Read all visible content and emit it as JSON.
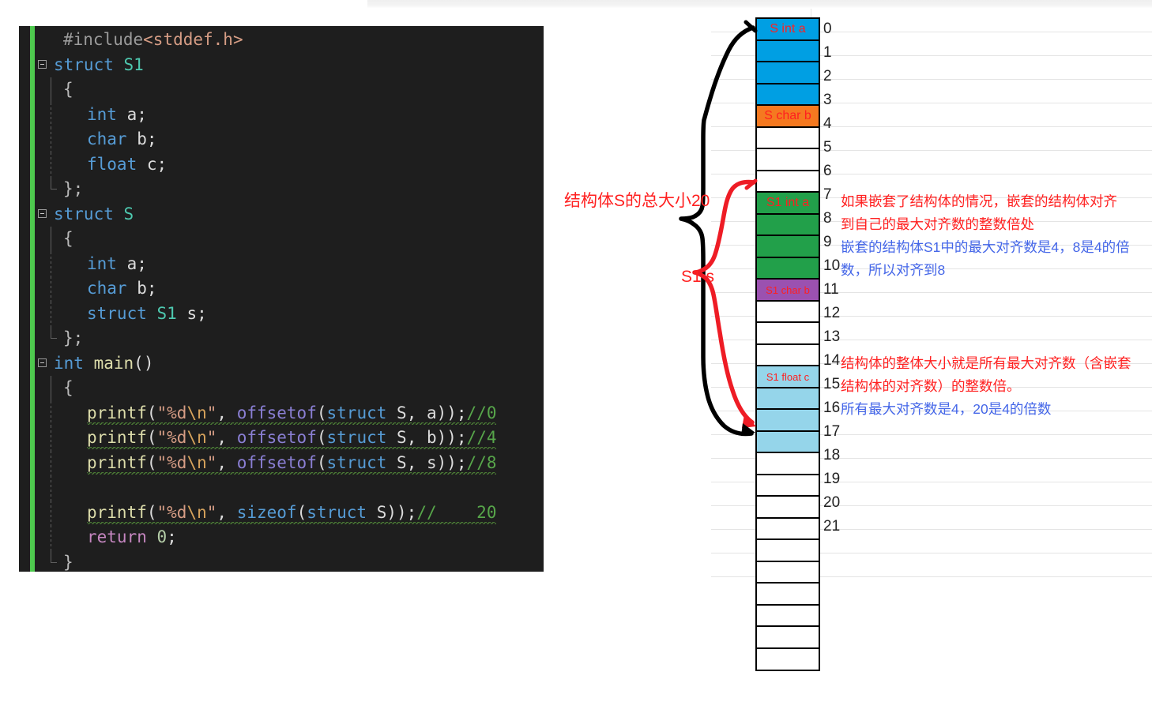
{
  "code_editor": {
    "lines": [
      [
        {
          "t": "#include",
          "c": "c-pp"
        },
        {
          "t": "<stddef.h>",
          "c": "c-ppfile"
        }
      ],
      [
        {
          "t": "struct ",
          "c": "c-key"
        },
        {
          "t": "S1",
          "c": "c-type"
        }
      ],
      [
        {
          "t": "{",
          "c": "c-dim"
        }
      ],
      [
        {
          "t": "int",
          "c": "c-key"
        },
        {
          "t": " a;",
          "c": "c-plain"
        }
      ],
      [
        {
          "t": "char",
          "c": "c-key"
        },
        {
          "t": " b;",
          "c": "c-plain"
        }
      ],
      [
        {
          "t": "float",
          "c": "c-key"
        },
        {
          "t": " c;",
          "c": "c-plain"
        }
      ],
      [
        {
          "t": "};",
          "c": "c-dim"
        }
      ],
      [
        {
          "t": "struct ",
          "c": "c-key"
        },
        {
          "t": "S",
          "c": "c-type"
        }
      ],
      [
        {
          "t": "{",
          "c": "c-dim"
        }
      ],
      [
        {
          "t": "int",
          "c": "c-key"
        },
        {
          "t": " a;",
          "c": "c-plain"
        }
      ],
      [
        {
          "t": "char",
          "c": "c-key"
        },
        {
          "t": " b;",
          "c": "c-plain"
        }
      ],
      [
        {
          "t": "struct ",
          "c": "c-key"
        },
        {
          "t": "S1",
          "c": "c-type"
        },
        {
          "t": " s;",
          "c": "c-plain"
        }
      ],
      [
        {
          "t": "};",
          "c": "c-dim"
        }
      ],
      [
        {
          "t": "int",
          "c": "c-key"
        },
        {
          "t": " ",
          "c": "c-plain"
        },
        {
          "t": "main",
          "c": "c-fn"
        },
        {
          "t": "()",
          "c": "c-punc"
        }
      ],
      [
        {
          "t": "{",
          "c": "c-dim"
        }
      ],
      [
        {
          "t": "printf",
          "c": "c-fn"
        },
        {
          "t": "(",
          "c": "c-punc"
        },
        {
          "t": "\"%d",
          "c": "c-str"
        },
        {
          "t": "\\n",
          "c": "c-esc"
        },
        {
          "t": "\"",
          "c": "c-str"
        },
        {
          "t": ", ",
          "c": "c-punc"
        },
        {
          "t": "offsetof",
          "c": "c-macro"
        },
        {
          "t": "(",
          "c": "c-punc"
        },
        {
          "t": "struct ",
          "c": "c-key"
        },
        {
          "t": "S",
          "c": "c-plain"
        },
        {
          "t": ", a));",
          "c": "c-punc"
        },
        {
          "t": "//0",
          "c": "c-cmt"
        }
      ],
      [
        {
          "t": "printf",
          "c": "c-fn"
        },
        {
          "t": "(",
          "c": "c-punc"
        },
        {
          "t": "\"%d",
          "c": "c-str"
        },
        {
          "t": "\\n",
          "c": "c-esc"
        },
        {
          "t": "\"",
          "c": "c-str"
        },
        {
          "t": ", ",
          "c": "c-punc"
        },
        {
          "t": "offsetof",
          "c": "c-macro"
        },
        {
          "t": "(",
          "c": "c-punc"
        },
        {
          "t": "struct ",
          "c": "c-key"
        },
        {
          "t": "S",
          "c": "c-plain"
        },
        {
          "t": ", b));",
          "c": "c-punc"
        },
        {
          "t": "//4",
          "c": "c-cmt"
        }
      ],
      [
        {
          "t": "printf",
          "c": "c-fn"
        },
        {
          "t": "(",
          "c": "c-punc"
        },
        {
          "t": "\"%d",
          "c": "c-str"
        },
        {
          "t": "\\n",
          "c": "c-esc"
        },
        {
          "t": "\"",
          "c": "c-str"
        },
        {
          "t": ", ",
          "c": "c-punc"
        },
        {
          "t": "offsetof",
          "c": "c-macro"
        },
        {
          "t": "(",
          "c": "c-punc"
        },
        {
          "t": "struct ",
          "c": "c-key"
        },
        {
          "t": "S",
          "c": "c-plain"
        },
        {
          "t": ", s));",
          "c": "c-punc"
        },
        {
          "t": "//8",
          "c": "c-cmt"
        }
      ],
      [],
      [
        {
          "t": "printf",
          "c": "c-fn"
        },
        {
          "t": "(",
          "c": "c-punc"
        },
        {
          "t": "\"%d",
          "c": "c-str"
        },
        {
          "t": "\\n",
          "c": "c-esc"
        },
        {
          "t": "\"",
          "c": "c-str"
        },
        {
          "t": ", ",
          "c": "c-punc"
        },
        {
          "t": "sizeof",
          "c": "c-key"
        },
        {
          "t": "(",
          "c": "c-punc"
        },
        {
          "t": "struct ",
          "c": "c-key"
        },
        {
          "t": "S",
          "c": "c-plain"
        },
        {
          "t": "));",
          "c": "c-punc"
        },
        {
          "t": "//    20",
          "c": "c-cmt"
        }
      ],
      [
        {
          "t": "return",
          "c": "c-ret"
        },
        {
          "t": " ",
          "c": "c-plain"
        },
        {
          "t": "0",
          "c": "c-num"
        },
        {
          "t": ";",
          "c": "c-punc"
        }
      ],
      [
        {
          "t": "}",
          "c": "c-dim"
        }
      ]
    ]
  },
  "memory_map": {
    "cells": [
      {
        "index": "0",
        "label": "S int a",
        "color": "#009FE3",
        "show_index": true
      },
      {
        "index": "1",
        "label": "",
        "color": "#009FE3",
        "show_index": true
      },
      {
        "index": "2",
        "label": "",
        "color": "#009FE3",
        "show_index": true
      },
      {
        "index": "3",
        "label": "",
        "color": "#009FE3",
        "show_index": true
      },
      {
        "index": "4",
        "label": "S char b",
        "color": "#F57920",
        "show_index": true
      },
      {
        "index": "5",
        "label": "",
        "color": "#FFFFFF",
        "show_index": true
      },
      {
        "index": "6",
        "label": "",
        "color": "#FFFFFF",
        "show_index": true
      },
      {
        "index": "7",
        "label": "",
        "color": "#FFFFFF",
        "show_index": true
      },
      {
        "index": "8",
        "label": "S1 int a",
        "color": "#22A04A",
        "show_index": true
      },
      {
        "index": "9",
        "label": "",
        "color": "#22A04A",
        "show_index": true
      },
      {
        "index": "10",
        "label": "",
        "color": "#22A04A",
        "show_index": true
      },
      {
        "index": "11",
        "label": "",
        "color": "#22A04A",
        "show_index": true
      },
      {
        "index": "12",
        "label": "S1 char b",
        "color": "#9B51B0",
        "show_index": true
      },
      {
        "index": "13",
        "label": "",
        "color": "#FFFFFF",
        "show_index": true
      },
      {
        "index": "14",
        "label": "",
        "color": "#FFFFFF",
        "show_index": true
      },
      {
        "index": "15",
        "label": "",
        "color": "#FFFFFF",
        "show_index": true
      },
      {
        "index": "16",
        "label": "S1 float c",
        "color": "#95D5EA",
        "show_index": true
      },
      {
        "index": "17",
        "label": "",
        "color": "#95D5EA",
        "show_index": true
      },
      {
        "index": "18",
        "label": "",
        "color": "#95D5EA",
        "show_index": true
      },
      {
        "index": "19",
        "label": "",
        "color": "#95D5EA",
        "show_index": true
      },
      {
        "index": "20",
        "label": "",
        "color": "#FFFFFF",
        "show_index": true
      },
      {
        "index": "21",
        "label": "",
        "color": "#FFFFFF",
        "show_index": true
      },
      {
        "index": "",
        "label": "",
        "color": "#FFFFFF",
        "show_index": false
      },
      {
        "index": "",
        "label": "",
        "color": "#FFFFFF",
        "show_index": false
      },
      {
        "index": "",
        "label": "",
        "color": "#FFFFFF",
        "show_index": false
      },
      {
        "index": "",
        "label": "",
        "color": "#FFFFFF",
        "show_index": false
      },
      {
        "index": "",
        "label": "",
        "color": "#FFFFFF",
        "show_index": false
      },
      {
        "index": "",
        "label": "",
        "color": "#FFFFFF",
        "show_index": false
      },
      {
        "index": "",
        "label": "",
        "color": "#FFFFFF",
        "show_index": false
      },
      {
        "index": "",
        "label": "",
        "color": "#FFFFFF",
        "show_index": false
      }
    ]
  },
  "annotations": {
    "total_size_label": "结构体S的总大小20",
    "s1_member_label": "S1 s",
    "note_nested": {
      "red_line_1": "如果嵌套了结构体的情况，嵌套的结构体对齐",
      "red_line_2": "到自己的最大对齐数的整数倍处",
      "blue_line_1": "嵌套的结构体S1中的最大对齐数是4，8是4的倍",
      "blue_line_2": "数，所以对齐到8"
    },
    "note_total": {
      "red_line_1": "结构体的整体大小就是所有最大对齐数（含嵌套",
      "red_line_2": "结构体的对齐数）的整数倍。",
      "blue_line_1": "所有最大对齐数是4，20是4的倍数"
    }
  },
  "colors": {
    "brace_outer": "#000000",
    "brace_inner": "#ee1c25",
    "annotation_red": "#ff2020",
    "annotation_blue": "#4466e8",
    "editor_background": "#1e1e1e",
    "editor_gutter_marker": "#4ec94e"
  }
}
